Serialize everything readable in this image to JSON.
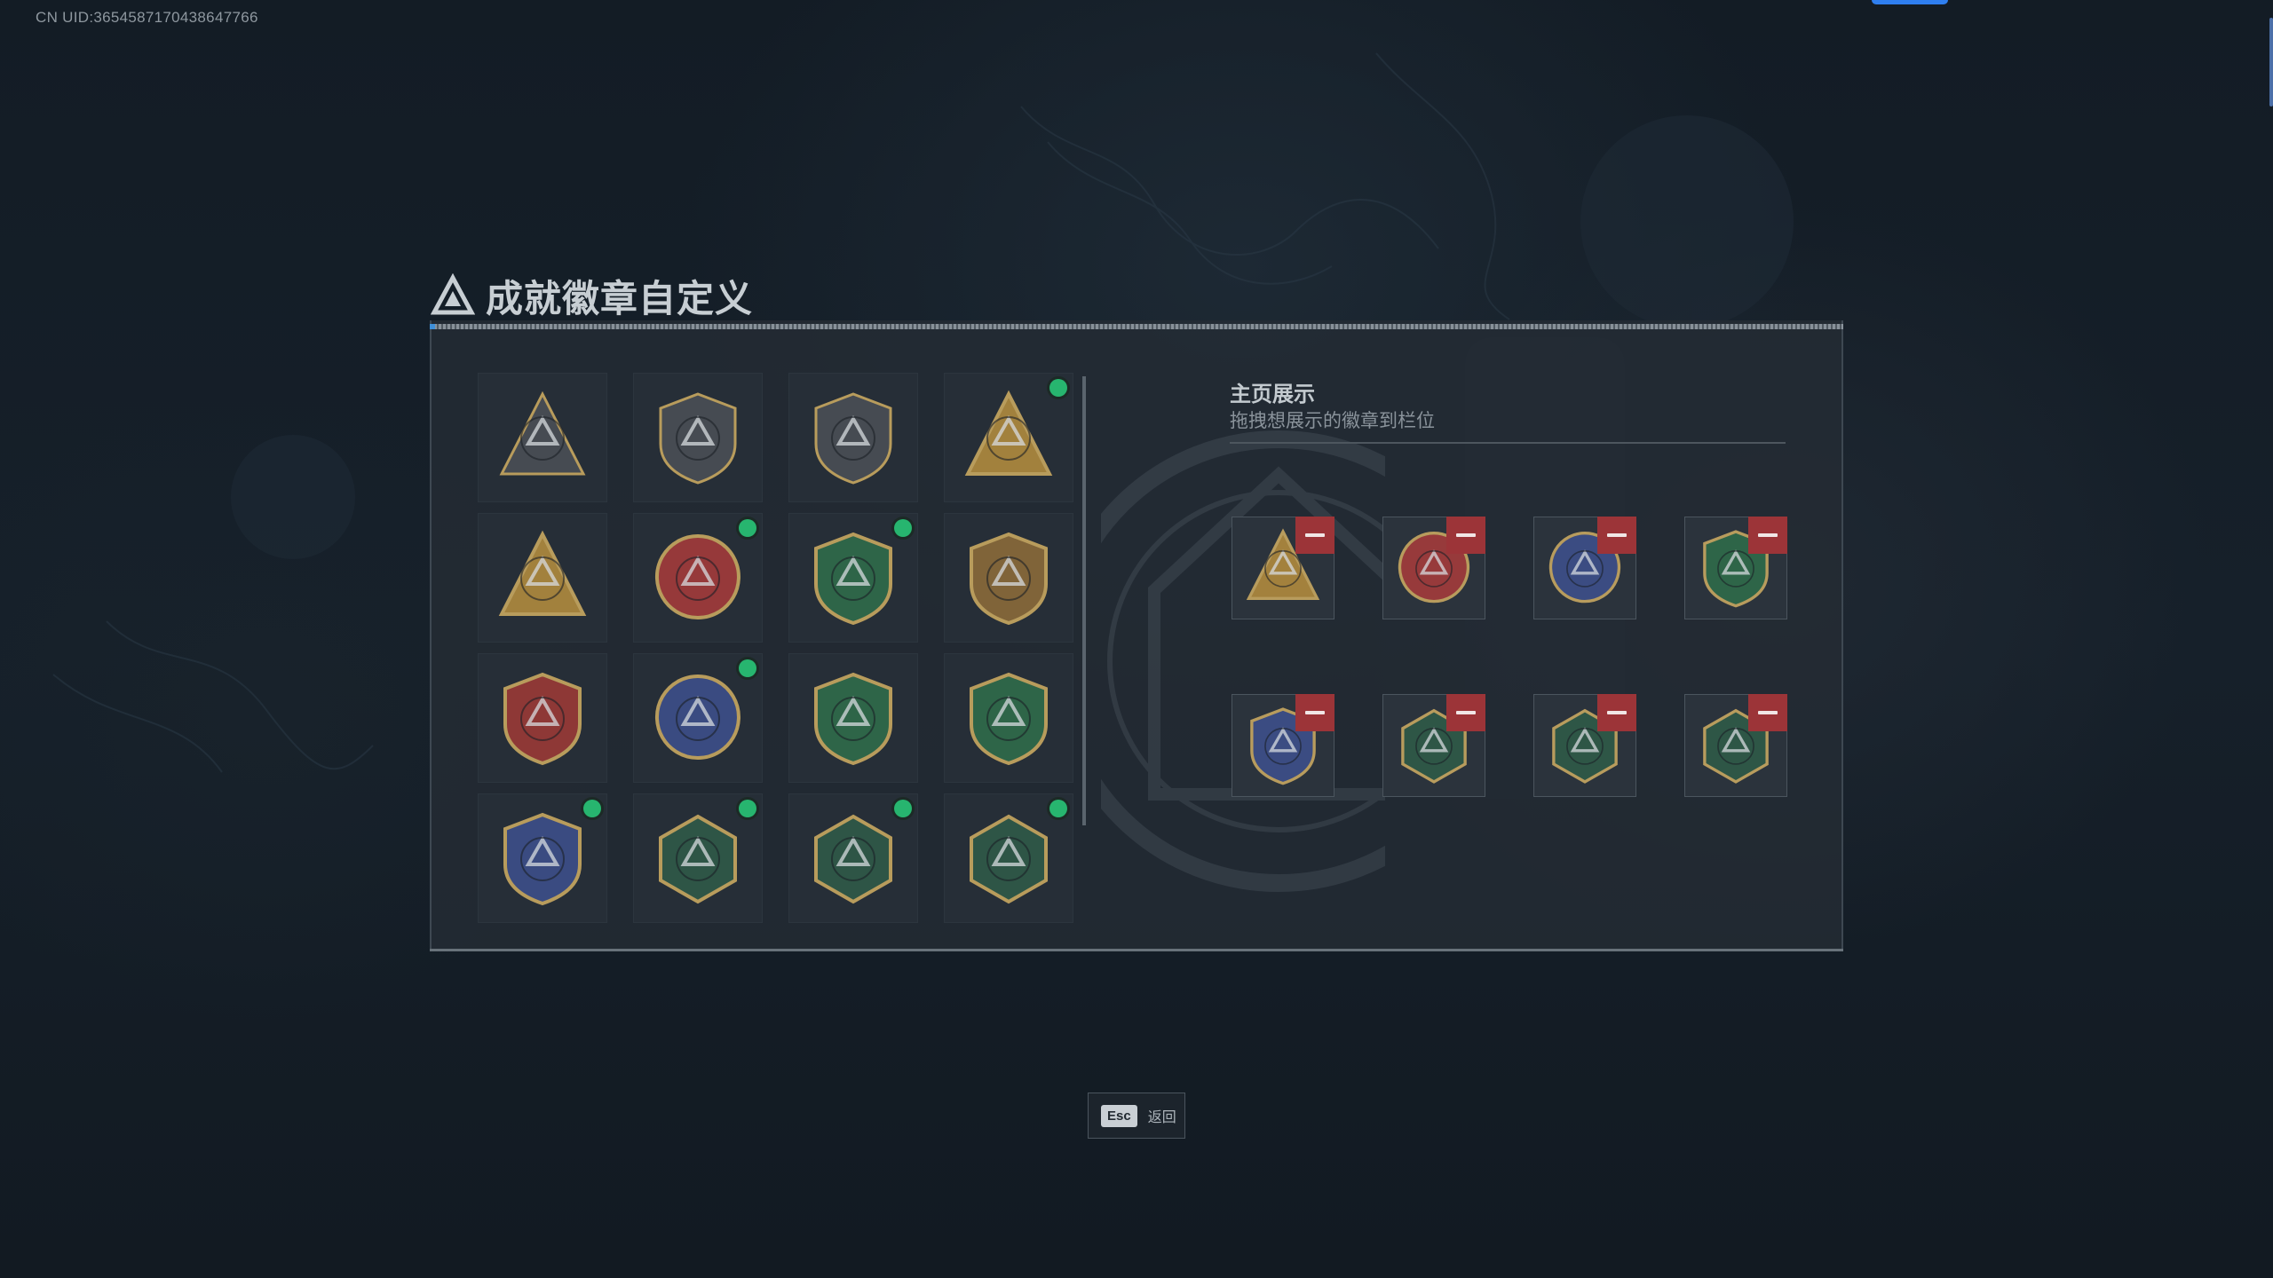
{
  "uid_text": "CN UID:3654587170438647766",
  "title": "成就徽章自定义",
  "collection": {
    "badges": [
      {
        "icon": "triangle-logo-shield-badge-icon",
        "color": "#4a4f55",
        "new": false
      },
      {
        "icon": "helicopter-shield-badge-icon",
        "color": "#4a4f55",
        "new": false
      },
      {
        "icon": "diamond-emblem-shield-badge-icon",
        "color": "#4a4f55",
        "new": false
      },
      {
        "icon": "s4-gold-triangle-badge-icon",
        "color": "#b08a3e",
        "new": true
      },
      {
        "icon": "s5-gold-triangle-badge-icon",
        "color": "#b08a3e",
        "new": false
      },
      {
        "icon": "star-compass-badge-icon",
        "color": "#a33b3b",
        "new": true
      },
      {
        "icon": "green-beret-shield-badge-icon",
        "color": "#2f6b4a",
        "new": true
      },
      {
        "icon": "bronze-wing-shield-badge-icon",
        "color": "#8a6a3a",
        "new": false
      },
      {
        "icon": "red-crest-shield-badge-icon",
        "color": "#9a3a36",
        "new": false
      },
      {
        "icon": "sniper-skull-round-badge-icon",
        "color": "#3d4f8a",
        "new": true
      },
      {
        "icon": "green-crosshair-rifle-badge-icon",
        "color": "#2f6b4a",
        "new": false
      },
      {
        "icon": "green-crosshair-rifle-badge-icon",
        "color": "#2f6b4a",
        "new": false
      },
      {
        "icon": "gold-blue-wing-shield-badge-icon",
        "color": "#3d4f8a",
        "new": true
      },
      {
        "icon": "wasp-hexagon-badge-icon",
        "color": "#2f5a48",
        "new": true
      },
      {
        "icon": "wasp-hexagon-badge-icon",
        "color": "#2f5a48",
        "new": true
      },
      {
        "icon": "green-hexagon-weapon-badge-icon",
        "color": "#2f5a48",
        "new": true
      }
    ]
  },
  "display": {
    "title": "主页展示",
    "subtitle": "拖拽想展示的徽章到栏位",
    "slots": [
      {
        "icon": "s4-gold-triangle-badge-icon",
        "color": "#b08a3e"
      },
      {
        "icon": "star-compass-badge-icon",
        "color": "#a33b3b"
      },
      {
        "icon": "sniper-skull-round-badge-icon",
        "color": "#3d4f8a"
      },
      {
        "icon": "green-beret-shield-badge-icon",
        "color": "#2f6b4a"
      },
      {
        "icon": "gold-blue-wing-shield-badge-icon",
        "color": "#3d4f8a"
      },
      {
        "icon": "wasp-hexagon-badge-icon",
        "color": "#2f5a48"
      },
      {
        "icon": "wasp-hexagon-badge-icon",
        "color": "#2f5a48"
      },
      {
        "icon": "green-hexagon-weapon-badge-icon",
        "color": "#2f5a48"
      }
    ]
  },
  "footer": {
    "esc_key": "Esc",
    "back_label": "返回"
  },
  "colors": {
    "accent_blue": "#2f7ff0",
    "new_dot": "#27b56f",
    "remove_red": "#9c3438"
  }
}
